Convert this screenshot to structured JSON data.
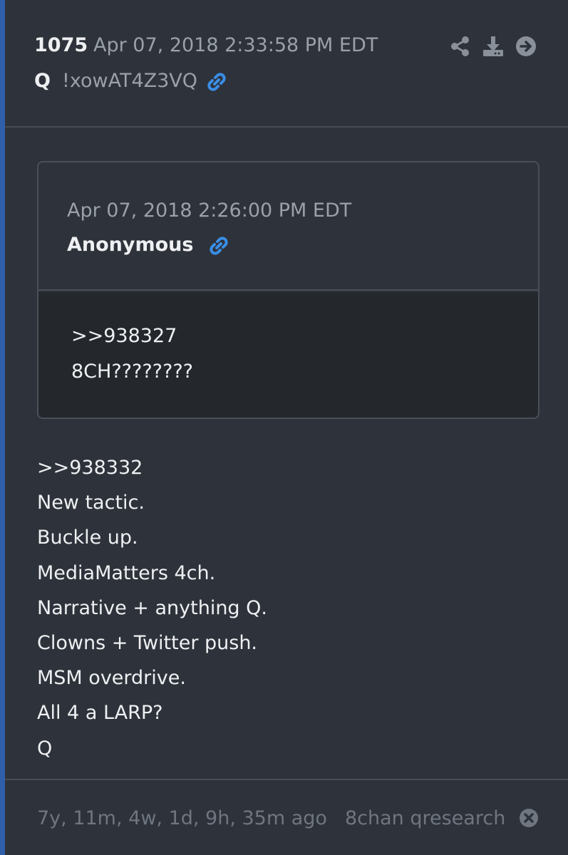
{
  "post": {
    "number": "1075",
    "date": "Apr 07, 2018 2:33:58 PM EDT",
    "author": "Q",
    "tripcode": "!xowAT4Z3VQ",
    "actions": [
      "share-icon",
      "download-icon",
      "arrow-right-icon"
    ]
  },
  "quoted": {
    "date": "Apr 07, 2018 2:26:00 PM EDT",
    "author": "Anonymous",
    "lines": [
      ">>938327",
      "8CH????????"
    ]
  },
  "body": {
    "lines": [
      ">>938332",
      "New tactic.",
      "Buckle up.",
      "MediaMatters 4ch.",
      "Narrative + anything Q.",
      "Clowns + Twitter push.",
      "MSM overdrive.",
      "All 4 a LARP?",
      "Q"
    ]
  },
  "footer": {
    "ago": "7y, 11m, 4w, 1d, 9h, 35m ago",
    "source": "8chan qresearch"
  },
  "colors": {
    "background": "#2e323a",
    "accent": "#2f5fa8",
    "link": "#3a8ee6",
    "muted": "#9aa1aa",
    "quote_body": "#24272c"
  }
}
